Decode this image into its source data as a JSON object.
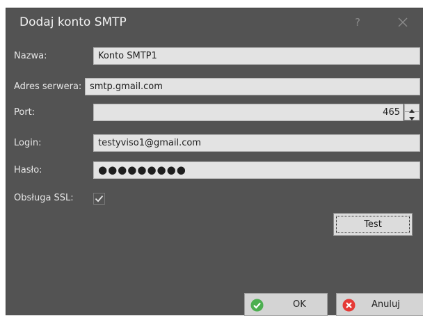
{
  "dialog": {
    "title": "Dodaj konto SMTP",
    "help_label": "?"
  },
  "form": {
    "name_label": "Nazwa:",
    "name_value": "Konto SMTP1",
    "server_label": "Adres serwera:",
    "server_value": "smtp.gmail.com",
    "port_label": "Port:",
    "port_value": "465",
    "login_label": "Login:",
    "login_value": "testyviso1@gmail.com",
    "password_label": "Hasło:",
    "password_value": "●●●●●●●●●",
    "ssl_label": "Obsługa SSL:",
    "ssl_checked": true
  },
  "buttons": {
    "test_label": "Test",
    "ok_label": "OK",
    "cancel_label": "Anuluj"
  },
  "colors": {
    "background": "#535353",
    "field": "#e3e3e3",
    "ok_icon": "#4caf50",
    "cancel_icon": "#e53935"
  },
  "icons": {
    "help": "question-mark-icon",
    "close": "close-x-icon",
    "ok": "check-circle-icon",
    "cancel": "x-circle-icon",
    "spin_up": "triangle-up-icon",
    "spin_down": "triangle-down-icon",
    "checkbox": "checkmark-icon"
  }
}
